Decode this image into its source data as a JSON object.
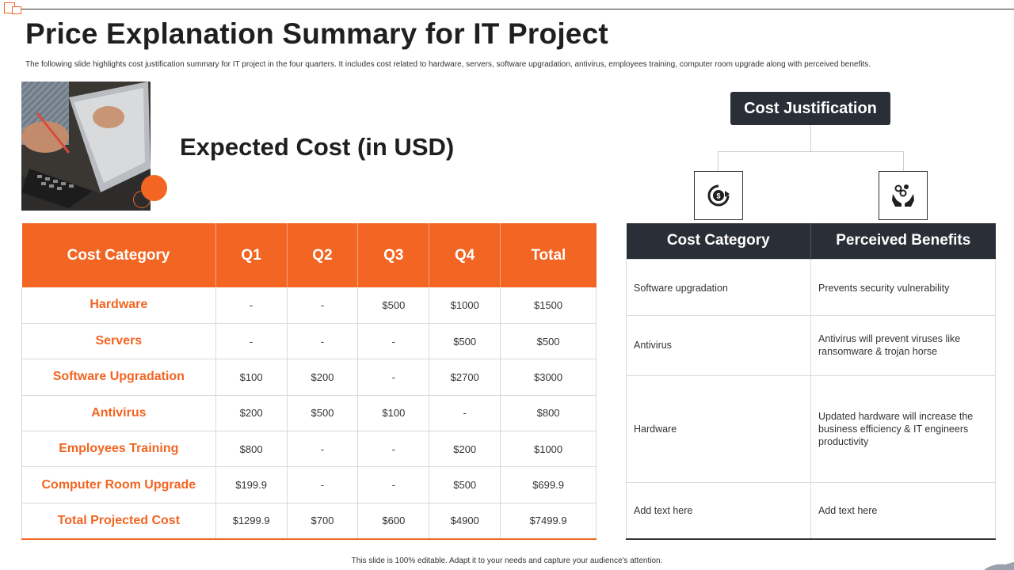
{
  "header": {
    "title": "Price Explanation Summary for IT Project",
    "subtitle": "The following slide highlights cost justification summary for IT project in the four quarters. It includes cost related to hardware, servers, software upgradation, antivirus, employees training, computer room upgrade along with perceived benefits."
  },
  "expected_cost": {
    "heading": "Expected Cost (in USD)",
    "columns": [
      "Cost Category",
      "Q1",
      "Q2",
      "Q3",
      "Q4",
      "Total"
    ],
    "rows": [
      [
        "Hardware",
        "-",
        "-",
        "$500",
        "$1000",
        "$1500"
      ],
      [
        "Servers",
        "-",
        "-",
        "-",
        "$500",
        "$500"
      ],
      [
        "Software Upgradation",
        "$100",
        "$200",
        "-",
        "$2700",
        "$3000"
      ],
      [
        "Antivirus",
        "$200",
        "$500",
        "$100",
        "-",
        "$800"
      ],
      [
        "Employees Training",
        "$800",
        "-",
        "-",
        "$200",
        "$1000"
      ],
      [
        "Computer Room Upgrade",
        "$199.9",
        "-",
        "-",
        "$500",
        "$699.9"
      ],
      [
        "Total Projected Cost",
        "$1299.9",
        "$700",
        "$600",
        "$4900",
        "$7499.9"
      ]
    ]
  },
  "justification": {
    "heading": "Cost Justification",
    "icons": [
      "dollar-cycle-icon",
      "hand-money-icon"
    ],
    "columns": [
      "Cost Category",
      "Perceived Benefits"
    ],
    "rows": [
      [
        "Software upgradation",
        "Prevents security vulnerability"
      ],
      [
        "Antivirus",
        "Antivirus will prevent viruses like ransomware & trojan horse"
      ],
      [
        "Hardware",
        "Updated hardware will increase the business efficiency & IT engineers productivity"
      ],
      [
        "Add text here",
        "Add text here"
      ]
    ]
  },
  "colors": {
    "accent": "#f26522",
    "dark": "#2a2e36"
  },
  "footer": {
    "text": "This slide is 100% editable. Adapt it to your needs and capture your audience's attention."
  }
}
